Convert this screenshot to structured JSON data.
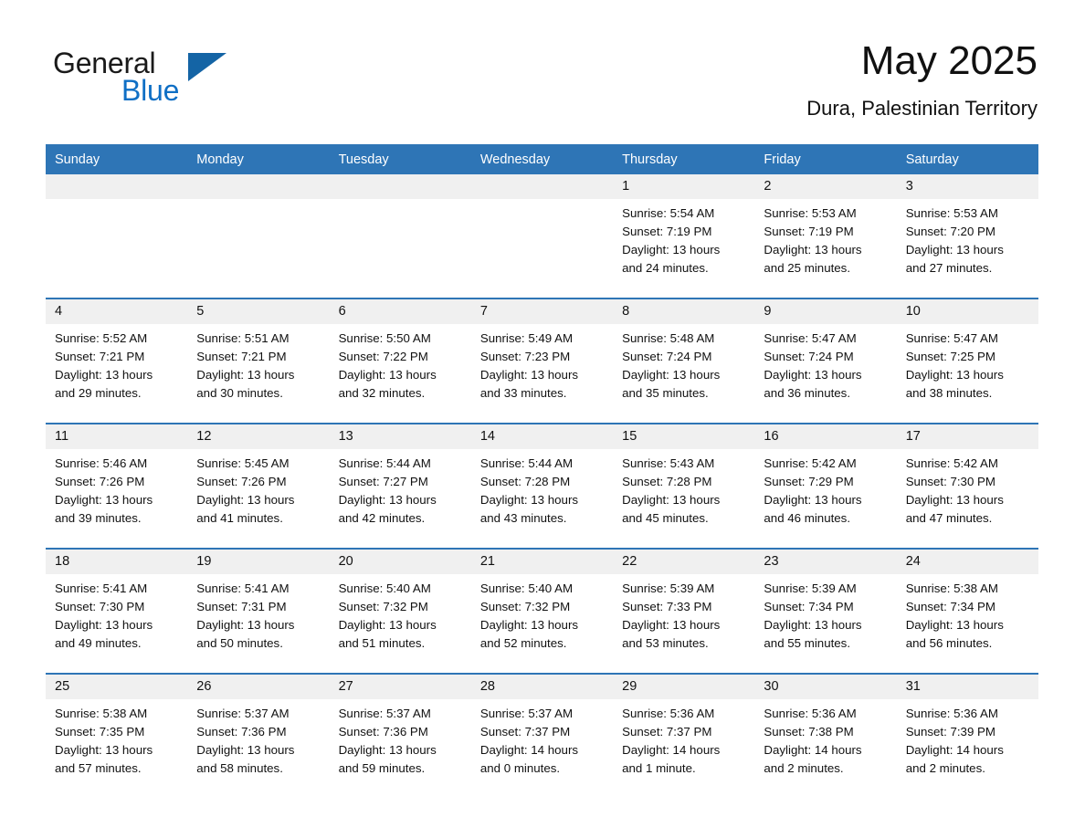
{
  "brand": {
    "logo_line1": "General",
    "logo_line2": "Blue",
    "logo_triangle_color": "#1464a5",
    "logo_blue_text_color": "#0f6fc5"
  },
  "header": {
    "month_title": "May 2025",
    "location": "Dura, Palestinian Territory"
  },
  "theme": {
    "header_bg": "#2e75b6",
    "header_text": "#ffffff",
    "daynum_band_bg": "#f0f0f0",
    "row_divider": "#2e75b6",
    "page_bg": "#ffffff",
    "body_text": "#111111"
  },
  "calendar": {
    "weekday_headers": [
      "Sunday",
      "Monday",
      "Tuesday",
      "Wednesday",
      "Thursday",
      "Friday",
      "Saturday"
    ],
    "weeks": [
      [
        {
          "day": "",
          "blank": true,
          "lines": []
        },
        {
          "day": "",
          "blank": true,
          "lines": []
        },
        {
          "day": "",
          "blank": true,
          "lines": []
        },
        {
          "day": "",
          "blank": true,
          "lines": []
        },
        {
          "day": "1",
          "blank": false,
          "lines": [
            "Sunrise: 5:54 AM",
            "Sunset: 7:19 PM",
            "Daylight: 13 hours",
            "and 24 minutes."
          ]
        },
        {
          "day": "2",
          "blank": false,
          "lines": [
            "Sunrise: 5:53 AM",
            "Sunset: 7:19 PM",
            "Daylight: 13 hours",
            "and 25 minutes."
          ]
        },
        {
          "day": "3",
          "blank": false,
          "lines": [
            "Sunrise: 5:53 AM",
            "Sunset: 7:20 PM",
            "Daylight: 13 hours",
            "and 27 minutes."
          ]
        }
      ],
      [
        {
          "day": "4",
          "blank": false,
          "lines": [
            "Sunrise: 5:52 AM",
            "Sunset: 7:21 PM",
            "Daylight: 13 hours",
            "and 29 minutes."
          ]
        },
        {
          "day": "5",
          "blank": false,
          "lines": [
            "Sunrise: 5:51 AM",
            "Sunset: 7:21 PM",
            "Daylight: 13 hours",
            "and 30 minutes."
          ]
        },
        {
          "day": "6",
          "blank": false,
          "lines": [
            "Sunrise: 5:50 AM",
            "Sunset: 7:22 PM",
            "Daylight: 13 hours",
            "and 32 minutes."
          ]
        },
        {
          "day": "7",
          "blank": false,
          "lines": [
            "Sunrise: 5:49 AM",
            "Sunset: 7:23 PM",
            "Daylight: 13 hours",
            "and 33 minutes."
          ]
        },
        {
          "day": "8",
          "blank": false,
          "lines": [
            "Sunrise: 5:48 AM",
            "Sunset: 7:24 PM",
            "Daylight: 13 hours",
            "and 35 minutes."
          ]
        },
        {
          "day": "9",
          "blank": false,
          "lines": [
            "Sunrise: 5:47 AM",
            "Sunset: 7:24 PM",
            "Daylight: 13 hours",
            "and 36 minutes."
          ]
        },
        {
          "day": "10",
          "blank": false,
          "lines": [
            "Sunrise: 5:47 AM",
            "Sunset: 7:25 PM",
            "Daylight: 13 hours",
            "and 38 minutes."
          ]
        }
      ],
      [
        {
          "day": "11",
          "blank": false,
          "lines": [
            "Sunrise: 5:46 AM",
            "Sunset: 7:26 PM",
            "Daylight: 13 hours",
            "and 39 minutes."
          ]
        },
        {
          "day": "12",
          "blank": false,
          "lines": [
            "Sunrise: 5:45 AM",
            "Sunset: 7:26 PM",
            "Daylight: 13 hours",
            "and 41 minutes."
          ]
        },
        {
          "day": "13",
          "blank": false,
          "lines": [
            "Sunrise: 5:44 AM",
            "Sunset: 7:27 PM",
            "Daylight: 13 hours",
            "and 42 minutes."
          ]
        },
        {
          "day": "14",
          "blank": false,
          "lines": [
            "Sunrise: 5:44 AM",
            "Sunset: 7:28 PM",
            "Daylight: 13 hours",
            "and 43 minutes."
          ]
        },
        {
          "day": "15",
          "blank": false,
          "lines": [
            "Sunrise: 5:43 AM",
            "Sunset: 7:28 PM",
            "Daylight: 13 hours",
            "and 45 minutes."
          ]
        },
        {
          "day": "16",
          "blank": false,
          "lines": [
            "Sunrise: 5:42 AM",
            "Sunset: 7:29 PM",
            "Daylight: 13 hours",
            "and 46 minutes."
          ]
        },
        {
          "day": "17",
          "blank": false,
          "lines": [
            "Sunrise: 5:42 AM",
            "Sunset: 7:30 PM",
            "Daylight: 13 hours",
            "and 47 minutes."
          ]
        }
      ],
      [
        {
          "day": "18",
          "blank": false,
          "lines": [
            "Sunrise: 5:41 AM",
            "Sunset: 7:30 PM",
            "Daylight: 13 hours",
            "and 49 minutes."
          ]
        },
        {
          "day": "19",
          "blank": false,
          "lines": [
            "Sunrise: 5:41 AM",
            "Sunset: 7:31 PM",
            "Daylight: 13 hours",
            "and 50 minutes."
          ]
        },
        {
          "day": "20",
          "blank": false,
          "lines": [
            "Sunrise: 5:40 AM",
            "Sunset: 7:32 PM",
            "Daylight: 13 hours",
            "and 51 minutes."
          ]
        },
        {
          "day": "21",
          "blank": false,
          "lines": [
            "Sunrise: 5:40 AM",
            "Sunset: 7:32 PM",
            "Daylight: 13 hours",
            "and 52 minutes."
          ]
        },
        {
          "day": "22",
          "blank": false,
          "lines": [
            "Sunrise: 5:39 AM",
            "Sunset: 7:33 PM",
            "Daylight: 13 hours",
            "and 53 minutes."
          ]
        },
        {
          "day": "23",
          "blank": false,
          "lines": [
            "Sunrise: 5:39 AM",
            "Sunset: 7:34 PM",
            "Daylight: 13 hours",
            "and 55 minutes."
          ]
        },
        {
          "day": "24",
          "blank": false,
          "lines": [
            "Sunrise: 5:38 AM",
            "Sunset: 7:34 PM",
            "Daylight: 13 hours",
            "and 56 minutes."
          ]
        }
      ],
      [
        {
          "day": "25",
          "blank": false,
          "lines": [
            "Sunrise: 5:38 AM",
            "Sunset: 7:35 PM",
            "Daylight: 13 hours",
            "and 57 minutes."
          ]
        },
        {
          "day": "26",
          "blank": false,
          "lines": [
            "Sunrise: 5:37 AM",
            "Sunset: 7:36 PM",
            "Daylight: 13 hours",
            "and 58 minutes."
          ]
        },
        {
          "day": "27",
          "blank": false,
          "lines": [
            "Sunrise: 5:37 AM",
            "Sunset: 7:36 PM",
            "Daylight: 13 hours",
            "and 59 minutes."
          ]
        },
        {
          "day": "28",
          "blank": false,
          "lines": [
            "Sunrise: 5:37 AM",
            "Sunset: 7:37 PM",
            "Daylight: 14 hours",
            "and 0 minutes."
          ]
        },
        {
          "day": "29",
          "blank": false,
          "lines": [
            "Sunrise: 5:36 AM",
            "Sunset: 7:37 PM",
            "Daylight: 14 hours",
            "and 1 minute."
          ]
        },
        {
          "day": "30",
          "blank": false,
          "lines": [
            "Sunrise: 5:36 AM",
            "Sunset: 7:38 PM",
            "Daylight: 14 hours",
            "and 2 minutes."
          ]
        },
        {
          "day": "31",
          "blank": false,
          "lines": [
            "Sunrise: 5:36 AM",
            "Sunset: 7:39 PM",
            "Daylight: 14 hours",
            "and 2 minutes."
          ]
        }
      ]
    ]
  }
}
